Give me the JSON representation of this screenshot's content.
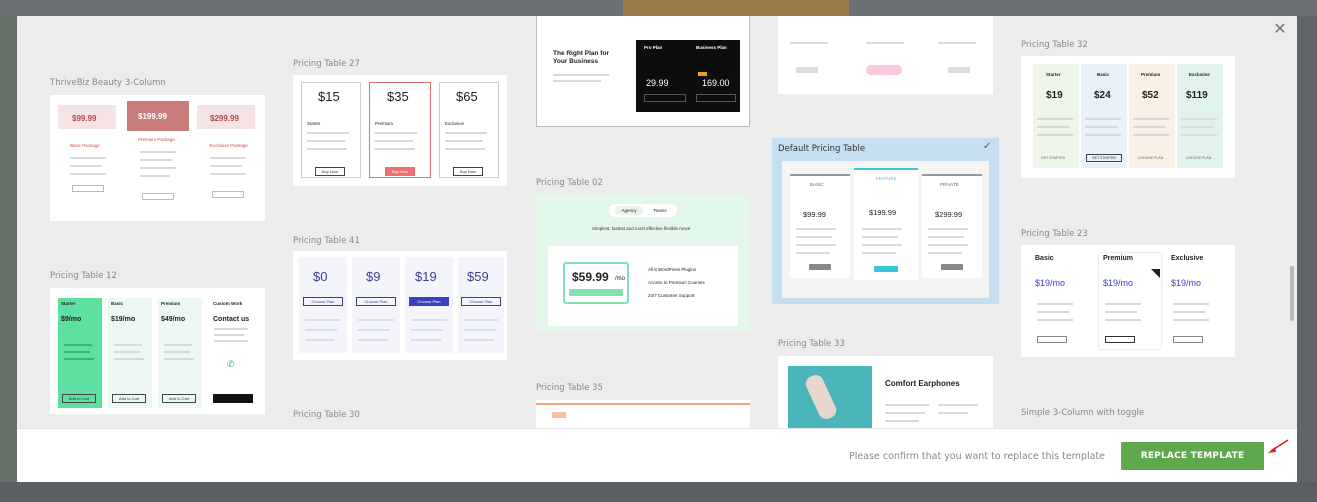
{
  "modal": {
    "close_icon": "✕"
  },
  "templates": {
    "col1": [
      {
        "name": "ThriveBiz Beauty 3-Column"
      },
      {
        "name": "Pricing Table 12"
      }
    ],
    "col2": [
      {
        "name": "Pricing Table 27"
      },
      {
        "name": "Pricing Table 41"
      },
      {
        "name": "Pricing Table 30"
      }
    ],
    "col3": [
      {
        "name": "Pricing Table 02"
      },
      {
        "name": "Pricing Table 35"
      }
    ],
    "col4": [
      {
        "name": "Default Pricing Table"
      },
      {
        "name": "Pricing Table 33"
      }
    ],
    "col5": [
      {
        "name": "Pricing Table 32"
      },
      {
        "name": "Pricing Table 23"
      },
      {
        "name": "Simple 3-Column with toggle"
      }
    ]
  },
  "previews": {
    "beauty": {
      "prices": [
        "$99.99",
        "$199.99",
        "$299.99"
      ],
      "plans": [
        "Basic Package",
        "Premium Package",
        "Exclusive Package"
      ]
    },
    "t27": {
      "prices": [
        "$15",
        "$35",
        "$65"
      ],
      "plans": [
        "Starter",
        "Premium",
        "Exclusive"
      ],
      "btn": "Buy Now"
    },
    "t41": {
      "prices": [
        "$0",
        "$9",
        "$19",
        "$59"
      ],
      "btn": "Choose Plan"
    },
    "t12": {
      "plans": [
        "Starter",
        "Basic",
        "Premium",
        "Custom Work"
      ],
      "prices": [
        "$9/mo",
        "$19/mo",
        "$49/mo"
      ],
      "contact": "Contact us",
      "btn": "Add to Cart"
    },
    "t02": {
      "tabs": [
        "Agency",
        "Teams"
      ],
      "subtitle": "Simplest, fastest and most effective flexible move",
      "price": "$59.99",
      "unit": "/mo",
      "features": [
        "All 8 WordPress Plugins",
        "Access to Premium Courses",
        "24/7 Customer Support"
      ]
    },
    "top3": {
      "heading": "The Right Plan for Your Business",
      "plans": [
        "Pro Plan",
        "Business Plan"
      ],
      "prices": [
        "29.99",
        "169.00"
      ]
    },
    "default": {
      "prices": [
        "$99.99",
        "$199.99",
        "$299.99"
      ],
      "plans": [
        "BASIC",
        "FEATURE",
        "PRIVATE"
      ]
    },
    "t33": {
      "title": "Comfort Earphones"
    },
    "t32": {
      "plans": [
        "Starter",
        "Basic",
        "Premium",
        "Exclusive"
      ],
      "prices": [
        "$19",
        "$24",
        "$52",
        "$119"
      ],
      "btns": [
        "GET STARTED",
        "GET STARTED",
        "CHOOSE PLAN",
        "CHOOSE PLAN"
      ]
    },
    "t23": {
      "plans": [
        "Basic",
        "Premium",
        "Exclusive"
      ],
      "prices": [
        "$19/mo",
        "$19/mo",
        "$19/mo"
      ]
    }
  },
  "footer": {
    "confirm_text": "Please confirm that you want to replace this template",
    "replace_label": "REPLACE TEMPLATE"
  },
  "colors": {
    "accent_green": "#5fa84e",
    "selected_bg": "#c6dff0",
    "arrow_red": "#e02020"
  }
}
